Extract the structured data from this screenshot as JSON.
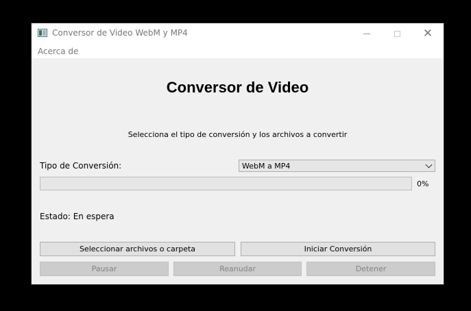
{
  "window": {
    "title": "Conversor de Video WebM y MP4",
    "controls": {
      "minimize_icon": "minimize-icon",
      "maximize_icon": "maximize-icon",
      "close_icon": "close-icon",
      "close_glyph": "✕"
    }
  },
  "menu": {
    "items": [
      {
        "label": "Acerca de"
      }
    ]
  },
  "main": {
    "heading": "Conversor de Video",
    "subtitle": "Selecciona el tipo de conversión y los archivos a convertir",
    "conversion_type": {
      "label": "Tipo de Conversión:",
      "selected": "WebM a MP4"
    },
    "progress": {
      "value": 0,
      "text": "0%",
      "fill_color": "#06b025"
    },
    "status": {
      "text": "Estado: En espera"
    },
    "buttons": {
      "select_files": "Seleccionar archivos o carpeta",
      "start": "Iniciar Conversión",
      "pause": "Pausar",
      "resume": "Reanudar",
      "stop": "Detener"
    }
  }
}
